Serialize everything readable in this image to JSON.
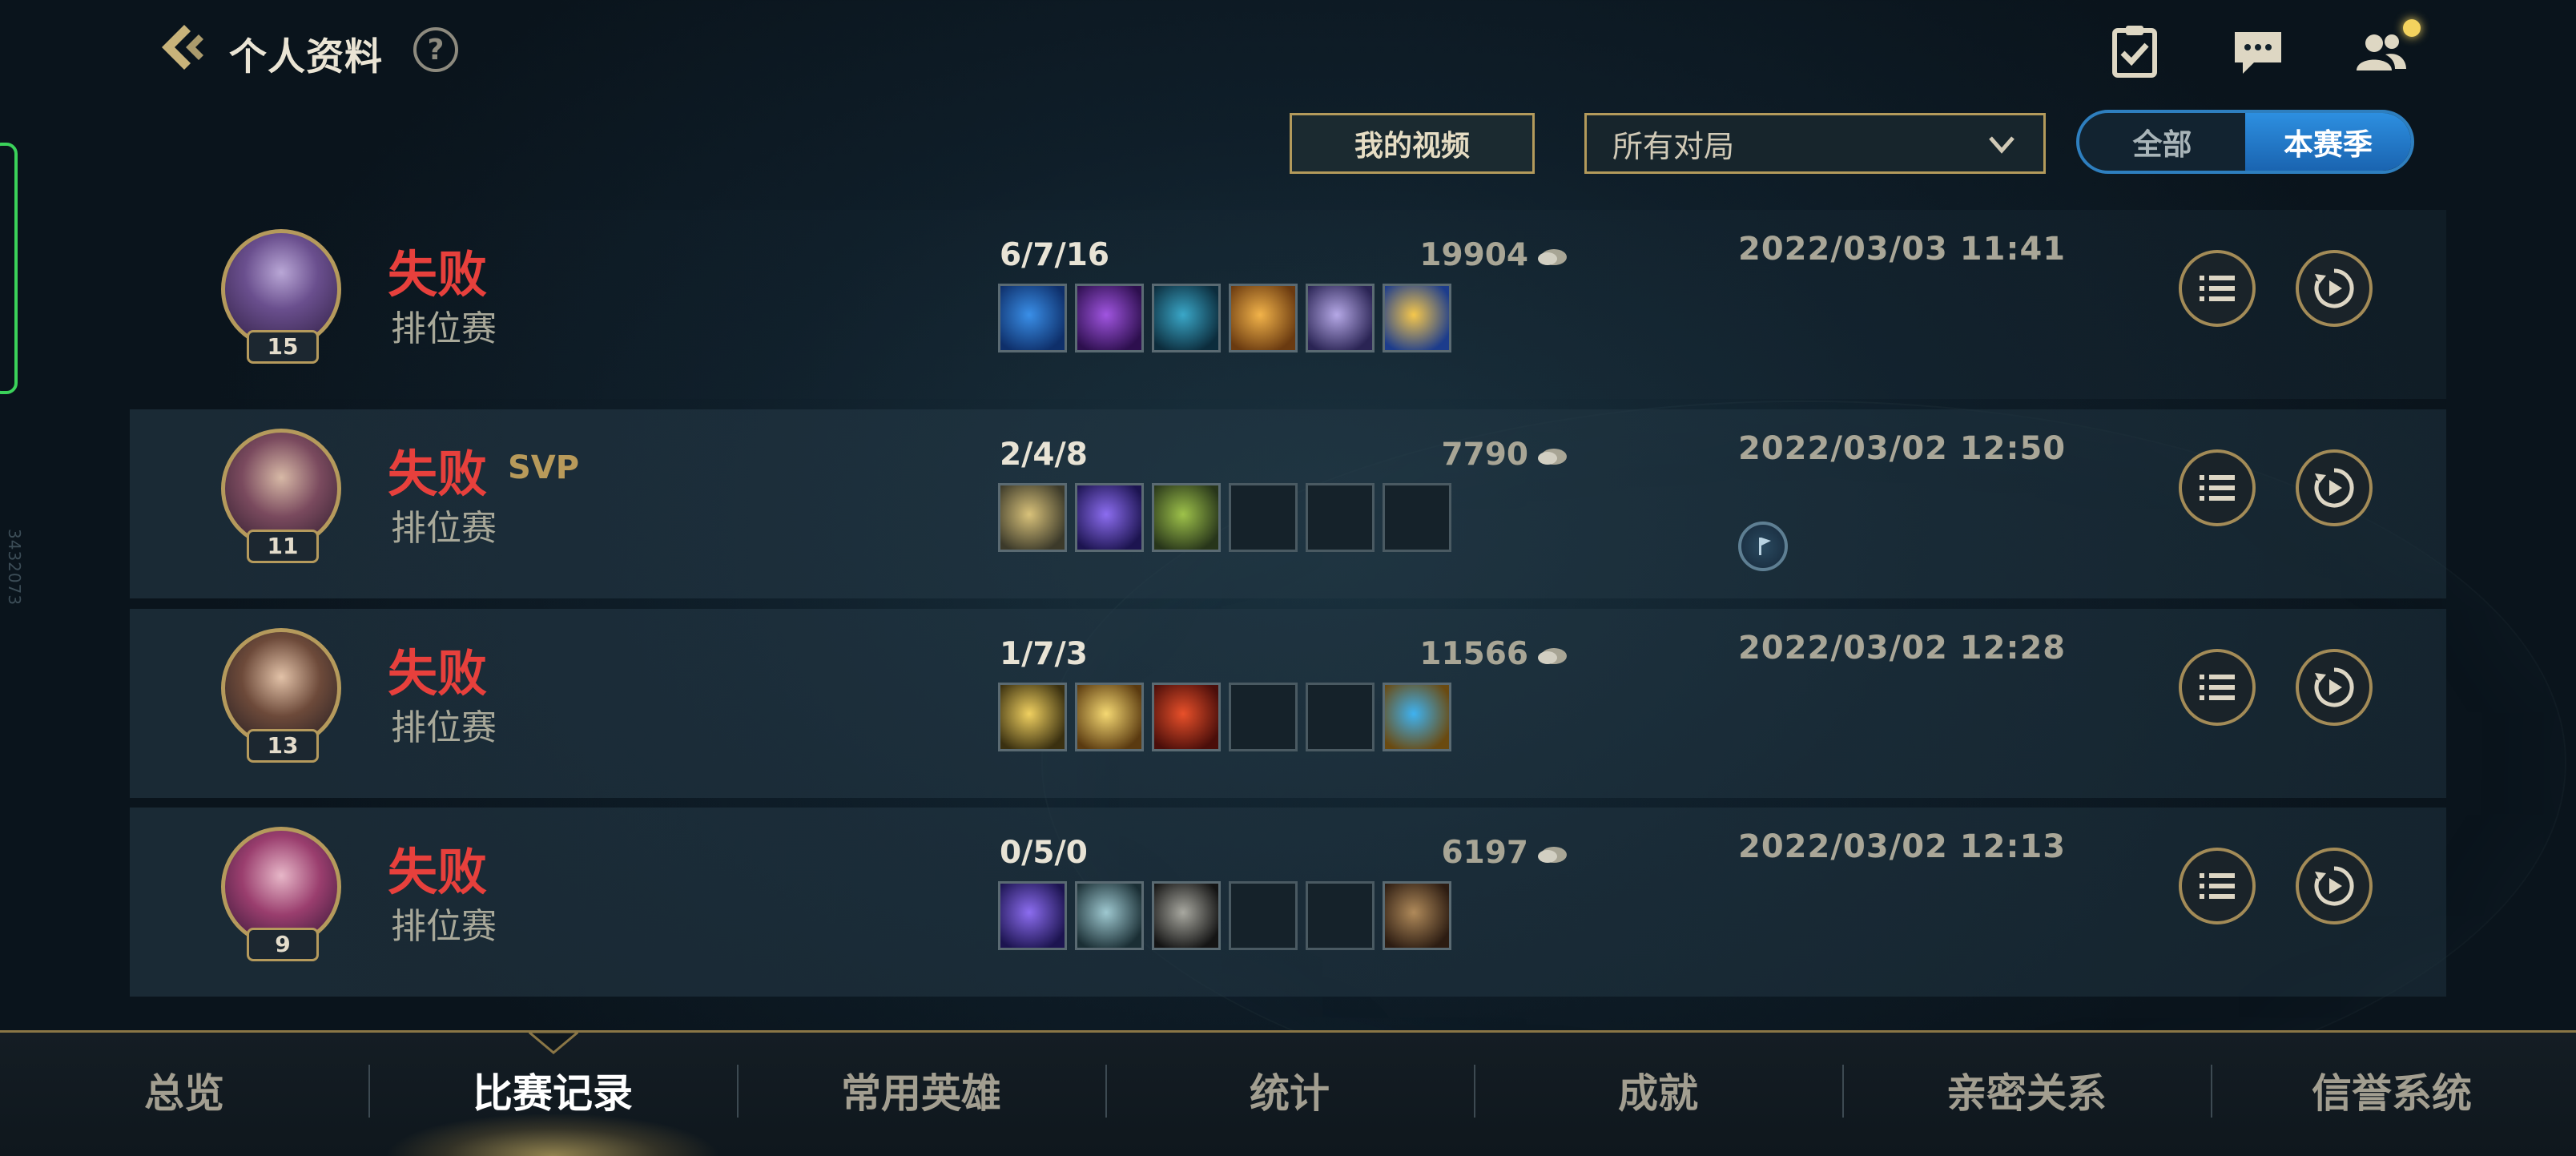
{
  "header": {
    "title": "个人资料",
    "help_label": "?",
    "icons": [
      "back-chevron-icon",
      "help-icon",
      "checklist-icon",
      "chat-icon",
      "friends-icon"
    ]
  },
  "side_id": "3432073",
  "filters": {
    "video_label": "我的视频",
    "match_type_value": "所有对局",
    "season_options": [
      "全部",
      "本赛季"
    ],
    "season_selected": "本赛季"
  },
  "matches": [
    {
      "level": "15",
      "result": "失败",
      "svp": "",
      "mode": "排位赛",
      "kda": "6/7/16",
      "gold": "19904",
      "date": "2022/03/03 11:41",
      "items": [
        "blue-blade",
        "purple-crown",
        "teal-cannon",
        "golden-wings",
        "silver-staff",
        "golden-chalice"
      ],
      "has_badge": false
    },
    {
      "level": "11",
      "result": "失败",
      "svp": "SVP",
      "mode": "排位赛",
      "kda": "2/4/8",
      "gold": "7790",
      "date": "2022/03/02 12:50",
      "items": [
        "gold-shuriken",
        "purple-shuriken",
        "green-spear",
        "",
        "",
        ""
      ],
      "has_badge": true
    },
    {
      "level": "13",
      "result": "失败",
      "svp": "",
      "mode": "排位赛",
      "kda": "1/7/3",
      "gold": "11566",
      "date": "2022/03/02 12:28",
      "items": [
        "gold-sword",
        "gold-greatsword",
        "red-blade",
        "",
        "",
        "blue-lantern"
      ],
      "has_badge": false
    },
    {
      "level": "9",
      "result": "失败",
      "svp": "",
      "mode": "排位赛",
      "kda": "0/5/0",
      "gold": "6197",
      "date": "2022/03/02 12:13",
      "items": [
        "purple-shuriken",
        "silver-dagger",
        "dark-gauntlet",
        "",
        "",
        "brown-boots"
      ],
      "has_badge": false
    }
  ],
  "nav": {
    "items": [
      "总览",
      "比赛记录",
      "常用英雄",
      "统计",
      "成就",
      "亲密关系",
      "信誉系统"
    ],
    "active": "比赛记录"
  },
  "colors": {
    "defeat": "#e7403c",
    "accent_gold": "#b39a5b",
    "toggle_active": "#2d8fe0"
  }
}
